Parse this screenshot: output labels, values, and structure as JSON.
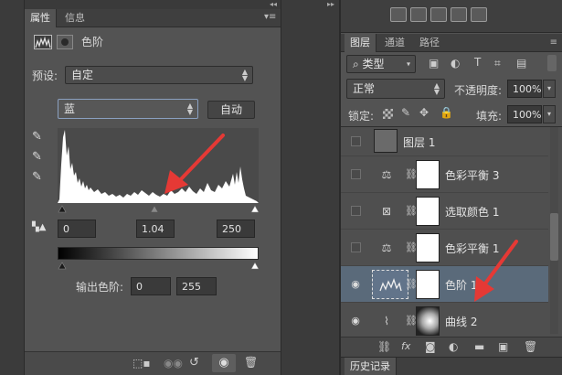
{
  "properties": {
    "tabs": [
      "属性",
      "信息"
    ],
    "title": "色阶",
    "preset_label": "预设:",
    "preset_value": "自定",
    "channel_value": "蓝",
    "auto_button": "自动",
    "input_black": "0",
    "input_gamma": "1.04",
    "input_white": "250",
    "output_label": "输出色阶:",
    "output_black": "0",
    "output_white": "255"
  },
  "layers_panel": {
    "tabs": [
      "图层",
      "通道",
      "路径"
    ],
    "kind_filter": "类型",
    "blend_mode": "正常",
    "opacity_label": "不透明度:",
    "opacity_value": "100%",
    "lock_label": "锁定:",
    "fill_label": "填充:",
    "fill_value": "100%",
    "layers": [
      {
        "name": "图层 1",
        "type": "pixel",
        "visible": false,
        "selected": false
      },
      {
        "name": "色彩平衡 3",
        "type": "color-balance",
        "visible": false,
        "selected": false
      },
      {
        "name": "选取颜色 1",
        "type": "selective-color",
        "visible": false,
        "selected": false
      },
      {
        "name": "色彩平衡 1",
        "type": "color-balance",
        "visible": false,
        "selected": false
      },
      {
        "name": "色阶 1",
        "type": "levels",
        "visible": true,
        "selected": true
      },
      {
        "name": "曲线 2",
        "type": "curves",
        "visible": true,
        "selected": false
      }
    ]
  },
  "history_panel": {
    "tab": "历史记录"
  },
  "annotation_color": "#e53935",
  "selection_color": "#5a6a7a"
}
